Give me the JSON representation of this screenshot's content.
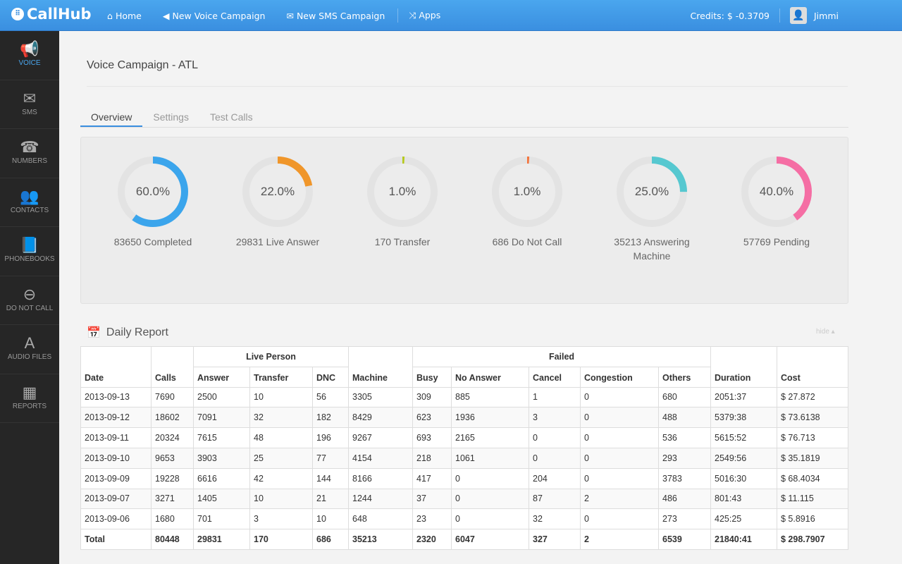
{
  "topbar": {
    "logo": "CallHub",
    "nav": [
      {
        "label": "Home",
        "icon": "home-icon",
        "glyph": "⌂"
      },
      {
        "label": "New Voice Campaign",
        "icon": "bullhorn-icon",
        "glyph": "◀"
      },
      {
        "label": "New SMS Campaign",
        "icon": "envelope-icon",
        "glyph": "✉"
      },
      {
        "label": "Apps",
        "icon": "shuffle-icon",
        "glyph": "⤨"
      }
    ],
    "credits": "Credits: $ -0.3709",
    "user": "Jimmi"
  },
  "sidebar": {
    "items": [
      {
        "label": "VOICE",
        "icon": "bullhorn-icon",
        "glyph": "📢",
        "active": true
      },
      {
        "label": "SMS",
        "icon": "envelope-icon",
        "glyph": "✉"
      },
      {
        "label": "NUMBERS",
        "icon": "phone-icon",
        "glyph": "☎"
      },
      {
        "label": "CONTACTS",
        "icon": "users-icon",
        "glyph": "👥"
      },
      {
        "label": "PHONEBOOKS",
        "icon": "book-icon",
        "glyph": "📘"
      },
      {
        "label": "DO NOT CALL",
        "icon": "minus-circle-icon",
        "glyph": "⊖"
      },
      {
        "label": "AUDIO FILES",
        "icon": "font-icon",
        "glyph": "A"
      },
      {
        "label": "REPORTS",
        "icon": "table-icon",
        "glyph": "▦"
      }
    ]
  },
  "page": {
    "title": "Voice Campaign - ATL",
    "tabs": [
      "Overview",
      "Settings",
      "Test Calls"
    ]
  },
  "stats": [
    {
      "pct": "60.0%",
      "value": 60,
      "label": "83650 Completed",
      "color": "#3ba5ec"
    },
    {
      "pct": "22.0%",
      "value": 22,
      "label": "29831 Live Answer",
      "color": "#f0962a"
    },
    {
      "pct": "1.0%",
      "value": 1,
      "label": "170 Transfer",
      "color": "#b5c91a"
    },
    {
      "pct": "1.0%",
      "value": 1,
      "label": "686 Do Not Call",
      "color": "#f4743c"
    },
    {
      "pct": "25.0%",
      "value": 25,
      "label": "35213 Answering Machine",
      "color": "#56c8d0"
    },
    {
      "pct": "40.0%",
      "value": 40,
      "label": "57769 Pending",
      "color": "#f56ea4"
    }
  ],
  "report": {
    "title": "Daily Report",
    "hide": "hide ▴",
    "groups": {
      "live": "Live Person",
      "failed": "Failed"
    },
    "headers": [
      "Date",
      "Calls",
      "Answer",
      "Transfer",
      "DNC",
      "Machine",
      "Busy",
      "No Answer",
      "Cancel",
      "Congestion",
      "Others",
      "Duration",
      "Cost"
    ],
    "rows": [
      [
        "2013-09-13",
        "7690",
        "2500",
        "10",
        "56",
        "3305",
        "309",
        "885",
        "1",
        "0",
        "680",
        "2051:37",
        "$ 27.872"
      ],
      [
        "2013-09-12",
        "18602",
        "7091",
        "32",
        "182",
        "8429",
        "623",
        "1936",
        "3",
        "0",
        "488",
        "5379:38",
        "$ 73.6138"
      ],
      [
        "2013-09-11",
        "20324",
        "7615",
        "48",
        "196",
        "9267",
        "693",
        "2165",
        "0",
        "0",
        "536",
        "5615:52",
        "$ 76.713"
      ],
      [
        "2013-09-10",
        "9653",
        "3903",
        "25",
        "77",
        "4154",
        "218",
        "1061",
        "0",
        "0",
        "293",
        "2549:56",
        "$ 35.1819"
      ],
      [
        "2013-09-09",
        "19228",
        "6616",
        "42",
        "144",
        "8166",
        "417",
        "0",
        "204",
        "0",
        "3783",
        "5016:30",
        "$ 68.4034"
      ],
      [
        "2013-09-07",
        "3271",
        "1405",
        "10",
        "21",
        "1244",
        "37",
        "0",
        "87",
        "2",
        "486",
        "801:43",
        "$ 11.115"
      ],
      [
        "2013-09-06",
        "1680",
        "701",
        "3",
        "10",
        "648",
        "23",
        "0",
        "32",
        "0",
        "273",
        "425:25",
        "$ 5.8916"
      ]
    ],
    "total": [
      "Total",
      "80448",
      "29831",
      "170",
      "686",
      "35213",
      "2320",
      "6047",
      "327",
      "2",
      "6539",
      "21840:41",
      "$ 298.7907"
    ]
  }
}
